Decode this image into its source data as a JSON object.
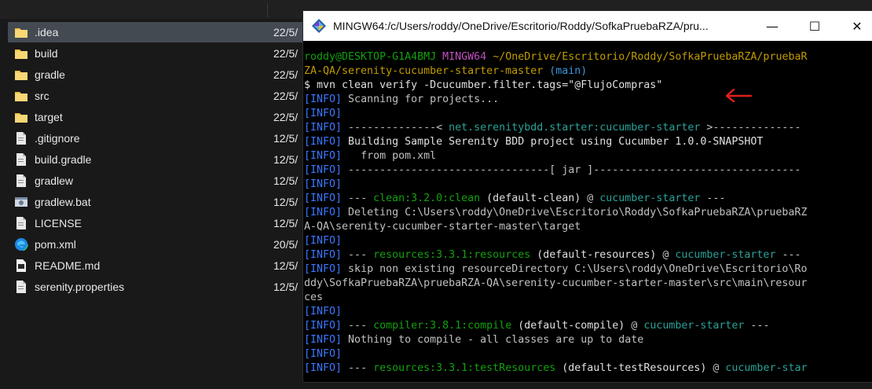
{
  "explorer": {
    "files": [
      {
        "name": ".idea",
        "date": "22/5/",
        "icon": "folder-icon",
        "selected": true
      },
      {
        "name": "build",
        "date": "22/5/",
        "icon": "folder-icon"
      },
      {
        "name": "gradle",
        "date": "22/5/",
        "icon": "folder-icon"
      },
      {
        "name": "src",
        "date": "22/5/",
        "icon": "folder-icon"
      },
      {
        "name": "target",
        "date": "22/5/",
        "icon": "folder-icon"
      },
      {
        "name": ".gitignore",
        "date": "12/5/",
        "icon": "file-icon"
      },
      {
        "name": "build.gradle",
        "date": "12/5/",
        "icon": "file-icon"
      },
      {
        "name": "gradlew",
        "date": "12/5/",
        "icon": "file-icon"
      },
      {
        "name": "gradlew.bat",
        "date": "12/5/",
        "icon": "settings-file-icon"
      },
      {
        "name": "LICENSE",
        "date": "12/5/",
        "icon": "file-icon"
      },
      {
        "name": "pom.xml",
        "date": "20/5/",
        "icon": "edge-icon"
      },
      {
        "name": "README.md",
        "date": "12/5/",
        "icon": "markdown-file-icon"
      },
      {
        "name": "serenity.properties",
        "date": "12/5/",
        "icon": "file-icon"
      }
    ]
  },
  "terminal": {
    "title": "MINGW64:/c/Users/roddy/OneDrive/Escritorio/Roddy/SofkaPruebaRZA/pru...",
    "buttons": {
      "minimize": "—",
      "maximize": "☐",
      "close": "✕"
    },
    "prompt": {
      "user": "roddy@DESKTOP-G1A4BMJ",
      "env": "MINGW64",
      "path_1": "~/OneDrive/Escritorio/Roddy/SofkaPruebaRZA/pruebaR",
      "path_2": "ZA-QA/serenity-cucumber-starter-master",
      "branch": "(main)",
      "command": "$ mvn clean verify -Dcucumber.filter.tags=\"@FlujoCompras\""
    },
    "tag": "[INFO]",
    "lines": {
      "l1": " Scanning for projects...",
      "l3_a": " --------------< ",
      "l3_b": "net.serenitybdd.starter:cucumber-starter",
      "l3_c": " >--------------",
      "l4": " Building Sample Serenity BDD project using Cucumber 1.0.0-SNAPSHOT",
      "l5": "   from pom.xml",
      "l6": " --------------------------------[ jar ]---------------------------------",
      "l8_a": " --- ",
      "l8_b": "clean:3.2.0:clean",
      "l8_c": " (default-clean) ",
      "l8_d": "@ ",
      "l8_e": "cucumber-starter",
      "l8_f": " ---",
      "l9": " Deleting C:\\Users\\roddy\\OneDrive\\Escritorio\\Roddy\\SofkaPruebaRZA\\pruebaRZ",
      "l9b": "A-QA\\serenity-cucumber-starter-master\\target",
      "l11_a": " --- ",
      "l11_b": "resources:3.3.1:resources",
      "l11_c": " (default-resources) ",
      "l11_d": "@ ",
      "l11_e": "cucumber-starter",
      "l11_f": " ---",
      "l12": " skip non existing resourceDirectory C:\\Users\\roddy\\OneDrive\\Escritorio\\Ro",
      "l12b": "ddy\\SofkaPruebaRZA\\pruebaRZA-QA\\serenity-cucumber-starter-master\\src\\main\\resour",
      "l12c": "ces",
      "l14_a": " --- ",
      "l14_b": "compiler:3.8.1:compile",
      "l14_c": " (default-compile) ",
      "l14_d": "@ ",
      "l14_e": "cucumber-starter",
      "l14_f": " ---",
      "l15": " Nothing to compile - all classes are up to date",
      "l17_a": " --- ",
      "l17_b": "resources:3.3.1:testResources",
      "l17_c": " (default-testResources) ",
      "l17_d": "@ ",
      "l17_e": "cucumber-star"
    }
  },
  "colors": {
    "annotation_arrow": "#e0201b",
    "info_tag": "#3b78ff",
    "green": "#13a10e",
    "magenta": "#c150c1",
    "yellow": "#c19c00",
    "cyan": "#3a96dd"
  }
}
